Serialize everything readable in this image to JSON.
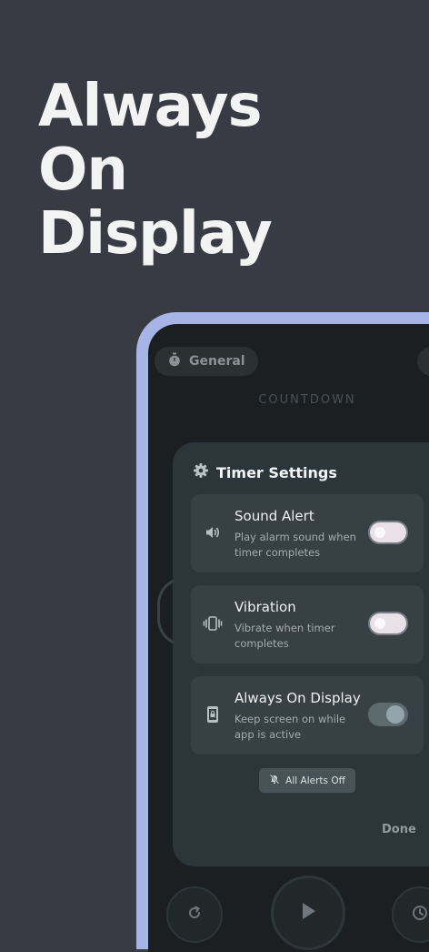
{
  "headline": [
    "Always",
    "On",
    "Display"
  ],
  "screen": {
    "chip_label": "General",
    "countdown_label": "COUNTDOWN"
  },
  "settings": {
    "title": "Timer Settings",
    "items": [
      {
        "title": "Sound Alert",
        "description": "Play alarm sound when timer completes",
        "icon": "speaker-icon",
        "enabled": false
      },
      {
        "title": "Vibration",
        "description": "Vibrate when timer completes",
        "icon": "vibration-icon",
        "enabled": false
      },
      {
        "title": "Always On Display",
        "description": "Keep screen on while app is active",
        "icon": "phone-lock-icon",
        "enabled": true
      }
    ],
    "alerts_off_label": "All Alerts Off",
    "done_label": "Done"
  },
  "colors": {
    "background": "#383b44",
    "device_frame": "#a7b5e6",
    "screen": "#1b1f22",
    "sheet": "#2c3539",
    "card": "#364045"
  }
}
